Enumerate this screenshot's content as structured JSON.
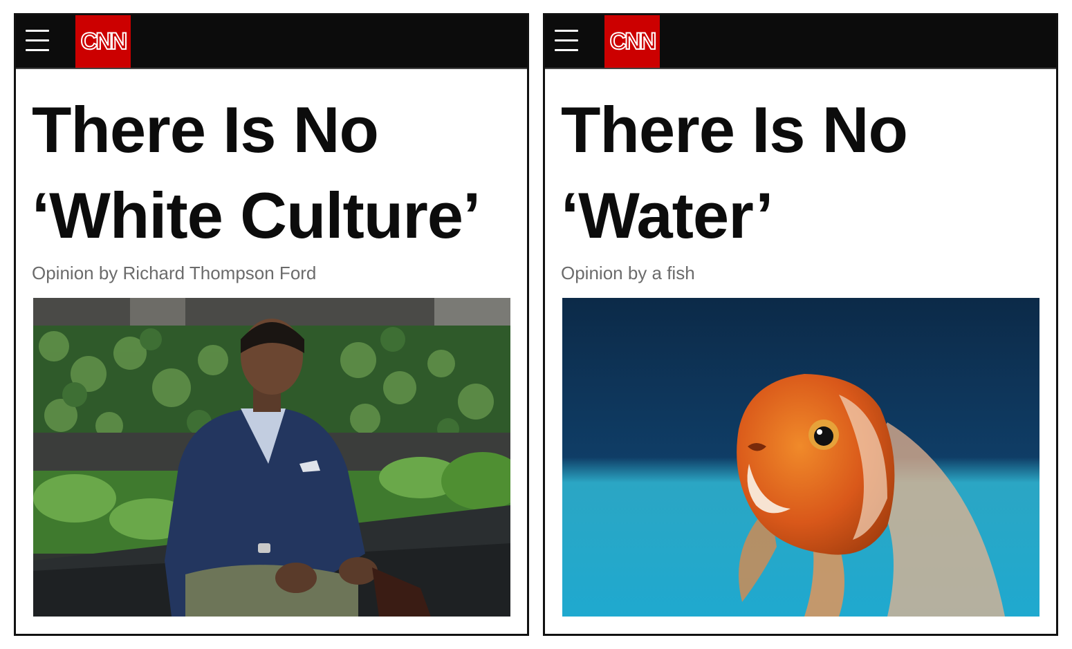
{
  "articles": [
    {
      "header": {
        "logo_text": "CNN",
        "menu_icon": "hamburger-menu-icon"
      },
      "headline_line1": "There Is No",
      "headline_line2": "‘White Culture’",
      "byline": "Opinion by Richard Thompson Ford",
      "photo_subject": "man in blue blazer seated in garden courtyard"
    },
    {
      "header": {
        "logo_text": "CNN",
        "menu_icon": "hamburger-menu-icon"
      },
      "headline_line1": "There Is No",
      "headline_line2": "‘Water’",
      "byline": "Opinion by a fish",
      "photo_subject": "orange goldfish in blue water"
    }
  ],
  "colors": {
    "brand_red": "#cc0000",
    "topbar": "#0c0c0c",
    "byline_gray": "#6b6b6b"
  }
}
